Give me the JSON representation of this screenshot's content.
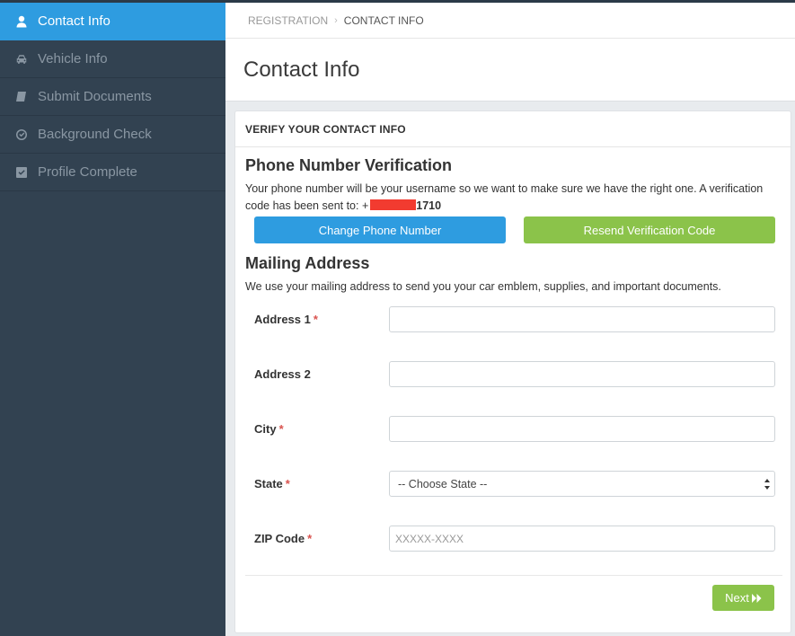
{
  "sidebar": {
    "items": [
      {
        "label": "Contact Info",
        "icon": "user-icon",
        "active": true
      },
      {
        "label": "Vehicle Info",
        "icon": "car-icon",
        "active": false
      },
      {
        "label": "Submit Documents",
        "icon": "book-icon",
        "active": false
      },
      {
        "label": "Background Check",
        "icon": "check-circle-icon",
        "active": false
      },
      {
        "label": "Profile Complete",
        "icon": "check-square-icon",
        "active": false
      }
    ]
  },
  "breadcrumb": {
    "parent": "REGISTRATION",
    "separator": "›",
    "current": "CONTACT INFO"
  },
  "page": {
    "title": "Contact Info"
  },
  "panel": {
    "heading": "VERIFY YOUR CONTACT INFO"
  },
  "phone": {
    "heading": "Phone Number Verification",
    "description": "Your phone number will be your username so we want to make sure we have the right one. A verification code has been sent to: +",
    "number_tail": "1710",
    "change_button": "Change Phone Number",
    "resend_button": "Resend Verification Code"
  },
  "mailing": {
    "heading": "Mailing Address",
    "description": "We use your mailing address to send you your car emblem, supplies, and important documents."
  },
  "form": {
    "address1_label": "Address 1",
    "address1_value": "",
    "address2_label": "Address 2",
    "address2_value": "",
    "city_label": "City",
    "city_value": "",
    "state_label": "State",
    "state_selected": "-- Choose State --",
    "zip_label": "ZIP Code",
    "zip_value": "",
    "zip_placeholder": "XXXXX-XXXX",
    "required_marker": "*"
  },
  "footer": {
    "next_label": "Next"
  },
  "colors": {
    "sidebar": "#324251",
    "active": "#2e9ce0",
    "green": "#8bc34a",
    "required": "#d9534f",
    "redaction": "#f23b30"
  }
}
